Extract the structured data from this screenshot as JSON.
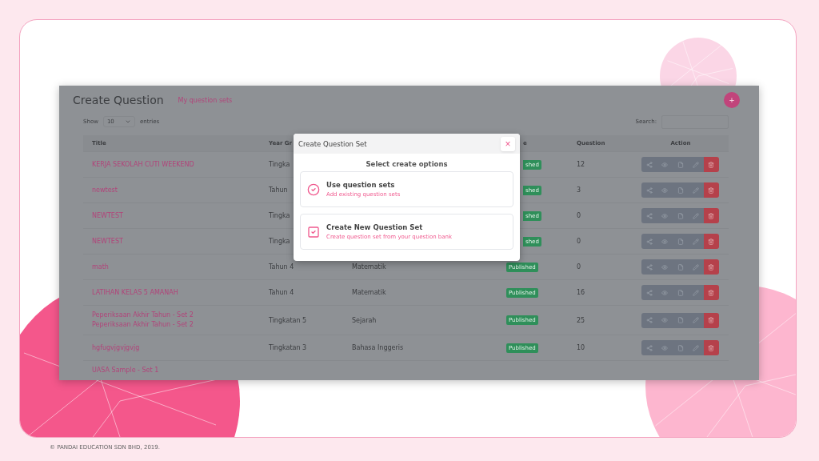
{
  "page": {
    "title": "Create Question",
    "link": "My question sets",
    "add_button": "+"
  },
  "controls": {
    "show_label": "Show",
    "page_size": "10",
    "entries_label": "entries",
    "search_label": "Search:"
  },
  "table": {
    "columns": [
      {
        "label": "Title"
      },
      {
        "label": "Year Gr"
      },
      {
        "label": "e",
        "cut": true
      },
      {
        "label": "Question"
      },
      {
        "label": "Action"
      }
    ],
    "rows": [
      {
        "titles": [
          "KERJA SEKOLAH CUTI WEEKEND"
        ],
        "year": "Tingka",
        "status": {
          "text": "shed",
          "cut": true
        },
        "questions": "12",
        "actions": true
      },
      {
        "titles": [
          "newtest"
        ],
        "year": "Tahun",
        "status": {
          "text": "shed",
          "cut": true
        },
        "questions": "3",
        "actions": true
      },
      {
        "titles": [
          "NEWTEST"
        ],
        "year": "Tingka",
        "status": {
          "text": "shed",
          "cut": true
        },
        "questions": "0",
        "actions": true
      },
      {
        "titles": [
          "NEWTEST"
        ],
        "year": "Tingka",
        "status": {
          "text": "shed",
          "cut": true
        },
        "questions": "0",
        "actions": true
      },
      {
        "titles": [
          "math"
        ],
        "year": "Tahun 4",
        "subject": "Matematik",
        "status": {
          "text": "Published",
          "cut": false
        },
        "questions": "0",
        "actions": true
      },
      {
        "titles": [
          "LATIHAN KELAS 5 AMANAH"
        ],
        "year": "Tahun 4",
        "subject": "Matematik",
        "status": {
          "text": "Published",
          "cut": false
        },
        "questions": "16",
        "actions": true
      },
      {
        "titles": [
          "Peperiksaan Akhir Tahun - Set 2",
          "Peperiksaan Akhir Tahun - Set 2"
        ],
        "year": "Tingkatan 5",
        "subject": "Sejarah",
        "status": {
          "text": "Published",
          "cut": false
        },
        "questions": "25",
        "actions": true
      },
      {
        "titles": [
          "hgfugvjgvjgvjg"
        ],
        "year": "Tingkatan 3",
        "subject": "Bahasa Inggeris",
        "status": {
          "text": "Published",
          "cut": false
        },
        "questions": "10",
        "actions": true
      },
      {
        "titles": [
          "UASA Sample - Set 1"
        ],
        "actions": false
      }
    ]
  },
  "modal": {
    "title": "Create Question Set",
    "close": "×",
    "prompt": "Select create options",
    "options": [
      {
        "kind": "use",
        "title": "Use question sets",
        "subtitle": "Add existing question sets"
      },
      {
        "kind": "create",
        "title": "Create New Question Set",
        "subtitle": "Create question set from your question bank"
      }
    ]
  },
  "footer": "© PANDAI EDUCATION SDN BHD, 2019."
}
